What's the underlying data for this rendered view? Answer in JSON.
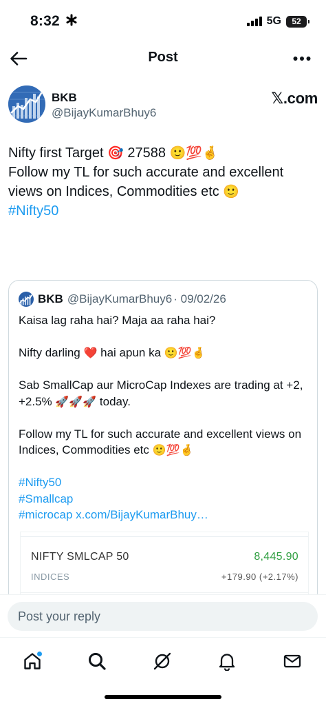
{
  "status_bar": {
    "time": "8:32",
    "network": "5G",
    "battery": "52"
  },
  "header": {
    "title": "Post"
  },
  "author": {
    "name": "BKB",
    "handle": "@BijayKumarBhuy6",
    "badge": "𝕏.com"
  },
  "tweet": {
    "line1_text": "Nifty first Target ",
    "line1_number": " 27588 ",
    "line1_emojis": "🙂💯🤞",
    "target_emoji": "🎯",
    "line2": "Follow my TL for such accurate and excellent views on Indices, Commodities etc ",
    "line2_emoji": "🙂",
    "hashtag": "#Nifty50"
  },
  "quote": {
    "name": "BKB",
    "handle": "@BijayKumarBhuy6",
    "date": "· 09/02/26",
    "line1": "Kaisa lag raha hai? Maja aa raha hai?",
    "line2_a": "Nifty darling ",
    "heart": "❤️",
    "line2_b": " hai apun ka ",
    "line2_emojis": "🙂💯🤞",
    "line3": "Sab SmallCap aur MicroCap Indexes are trading at +2, +2.5% ",
    "rockets": "🚀🚀🚀",
    "line3_end": " today.",
    "line4": "Follow my TL for such accurate and excellent views on Indices, Commodities etc ",
    "line4_emojis": "🙂💯🤞",
    "hashtag1": "#Nifty50",
    "hashtag2": "#Smallcap",
    "hashtag3": "#microcap",
    "link": "x.com/BijayKumarBhuy…"
  },
  "card": {
    "symbol": "NIFTY SMLCAP 50",
    "price": "8,445.90",
    "category": "INDICES",
    "change": "+179.90 (+2.17%)",
    "price_color": "#2e9e3f"
  },
  "reply": {
    "placeholder": "Post your reply"
  },
  "nav": {
    "items": [
      "home-icon",
      "search-icon",
      "grok-icon",
      "notifications-icon",
      "messages-icon"
    ],
    "accent": "#1d9bf0"
  }
}
